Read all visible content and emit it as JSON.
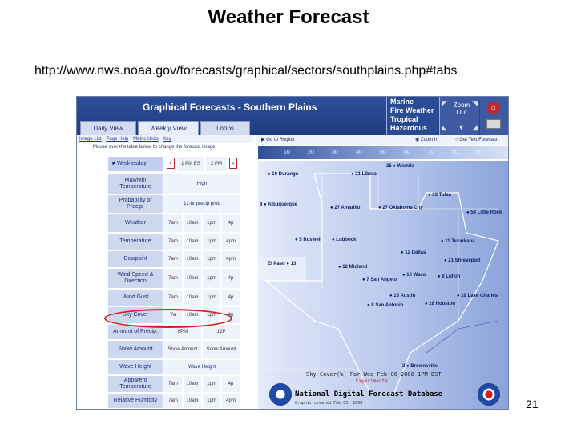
{
  "slide": {
    "title": "Weather Forecast",
    "url": "http://www.nws.noaa.gov/forecasts/graphical/sectors/southplains.php#tabs",
    "page_number": "21"
  },
  "header": {
    "title": "Graphical Forecasts - Southern Plains",
    "links": [
      "Marine",
      "Fire Weather",
      "Tropical",
      "Hazardous"
    ],
    "zoom_out_label": "Zoom Out",
    "home_icon": "home-icon",
    "print_icon": "printer-icon"
  },
  "tabs": [
    "Daily View",
    "Weekly View",
    "Loops"
  ],
  "active_tab": "Weekly View",
  "sub_links": [
    "Image List",
    "Page Help",
    "Metric Units",
    "Key"
  ],
  "instruction": "Mouse over the table below to change the forecast image",
  "map_controls": {
    "goto_region": "Go to Region",
    "zoom_in": "Zoom In",
    "get_text": "Get Text Forecast"
  },
  "table": {
    "day_label": "Wednesday",
    "day_times": [
      "1 PM ES",
      "2 PM"
    ],
    "rows": [
      {
        "label": "Max/Min Temperature",
        "wide": "High"
      },
      {
        "label": "Probability of Precip.",
        "wide": "12-hr precip prob"
      },
      {
        "label": "Weather",
        "cells": [
          "7am",
          "10am",
          "1pm",
          "4p"
        ]
      },
      {
        "label": "Temperature",
        "cells": [
          "7am",
          "10am",
          "1pm",
          "4pm"
        ]
      },
      {
        "label": "Dewpoint",
        "cells": [
          "7am",
          "10am",
          "1pm",
          "4pm"
        ]
      },
      {
        "label": "Wind Speed & Direction",
        "cells": [
          "7am",
          "10am",
          "1pm",
          "4p"
        ]
      },
      {
        "label": "Wind Gust",
        "cells": [
          "7am",
          "10am",
          "1pm",
          "4p"
        ]
      },
      {
        "label": "Sky Cover",
        "cells": [
          "7a",
          "10am",
          "1pm",
          "4p"
        ]
      },
      {
        "label": "Amount of Precip.",
        "cells": [
          "6PM",
          "12P"
        ]
      },
      {
        "label": "Snow Amount",
        "cells": [
          "Snow Amount",
          "Snow Amount"
        ]
      },
      {
        "label": "Wave Height",
        "wide": "Wave Height"
      },
      {
        "label": "Apparent Temperature",
        "cells": [
          "7am",
          "10am",
          "1pm",
          "4p"
        ]
      },
      {
        "label": "Relative Humidity",
        "cells": [
          "7am",
          "10am",
          "1pm",
          "4pm"
        ]
      }
    ]
  },
  "legend_ticks": [
    "10",
    "20",
    "30",
    "40",
    "50",
    "60",
    "70",
    "80",
    "90"
  ],
  "map": {
    "cities": [
      {
        "name": "Durango",
        "value": "10"
      },
      {
        "name": "Liberal",
        "value": "21"
      },
      {
        "name": "Wichita",
        "value": "25"
      },
      {
        "name": "Albuquerque",
        "value": "8"
      },
      {
        "name": "Amarillo",
        "value": "27"
      },
      {
        "name": "Oklahoma City",
        "value": "27"
      },
      {
        "name": "Tulsa",
        "value": "33"
      },
      {
        "name": "Little Rock",
        "value": "54"
      },
      {
        "name": "Roswell",
        "value": "5"
      },
      {
        "name": "Lubbock",
        "value": ""
      },
      {
        "name": "Dallas",
        "value": "12"
      },
      {
        "name": "Texarkana",
        "value": "11"
      },
      {
        "name": "El Paso",
        "value": "13"
      },
      {
        "name": "Midland",
        "value": "12"
      },
      {
        "name": "San Angelo",
        "value": "7"
      },
      {
        "name": "Waco",
        "value": "10"
      },
      {
        "name": "Shreveport",
        "value": "21"
      },
      {
        "name": "Lufkin",
        "value": "8"
      },
      {
        "name": "Austin",
        "value": "15"
      },
      {
        "name": "San Antonio",
        "value": "8"
      },
      {
        "name": "Houston",
        "value": "28"
      },
      {
        "name": "Lake Charles",
        "value": "19"
      },
      {
        "name": "Brownsville",
        "value": "2"
      }
    ],
    "caption": "Sky Cover(%) For Wed Feb 06 2008 1PM EST",
    "caption_status": "Experimental",
    "ndfd_title": "National Digital Forecast Database",
    "footnote": "Graphic created Feb 05, 2008"
  },
  "colors": {
    "header_bg": "#1f3b80",
    "label_bg": "#cdd8ef",
    "highlight_circle": "#d11f1f"
  }
}
